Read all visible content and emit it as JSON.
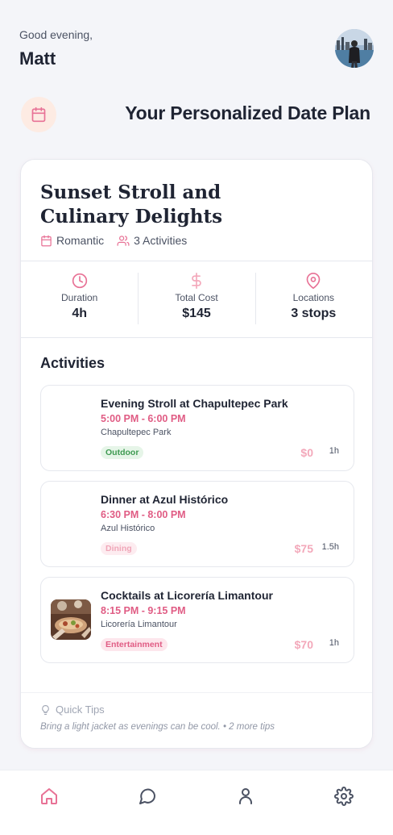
{
  "header": {
    "greeting": "Good evening,",
    "username": "Matt",
    "plan_heading": "Your Personalized Date Plan"
  },
  "plan": {
    "title": "Sunset Stroll and Culinary Delights",
    "category": "Romantic",
    "activities_count": "3 Activities",
    "stats": [
      {
        "label": "Duration",
        "value": "4h",
        "icon": "clock-icon"
      },
      {
        "label": "Total Cost",
        "value": "$145",
        "icon": "dollar-icon"
      },
      {
        "label": "Locations",
        "value": "3 stops",
        "icon": "map-pin-icon"
      }
    ]
  },
  "activities_section": {
    "title": "Activities",
    "items": [
      {
        "name": "Evening Stroll at Chapultepec Park",
        "time": "5:00 PM - 6:00 PM",
        "place": "Chapultepec Park",
        "tag": "Outdoor",
        "cost": "$0",
        "duration": "1h"
      },
      {
        "name": "Dinner at Azul Histórico",
        "time": "6:30 PM - 8:00 PM",
        "place": "Azul Histórico",
        "tag": "Dining",
        "cost": "$75",
        "duration": "1.5h"
      },
      {
        "name": "Cocktails at Licorería Limantour",
        "time": "8:15 PM - 9:15 PM",
        "place": "Licorería Limantour",
        "tag": "Entertainment",
        "cost": "$70",
        "duration": "1h"
      }
    ]
  },
  "tips": {
    "title": "Quick Tips",
    "text": "Bring a light jacket as evenings can be cool. • 2 more tips"
  },
  "colors": {
    "accent": "#e05c84",
    "accent_light": "#f3a8ba",
    "background": "#f4f5f9"
  },
  "nav": [
    "home-icon",
    "chat-icon",
    "user-icon",
    "settings-icon"
  ]
}
